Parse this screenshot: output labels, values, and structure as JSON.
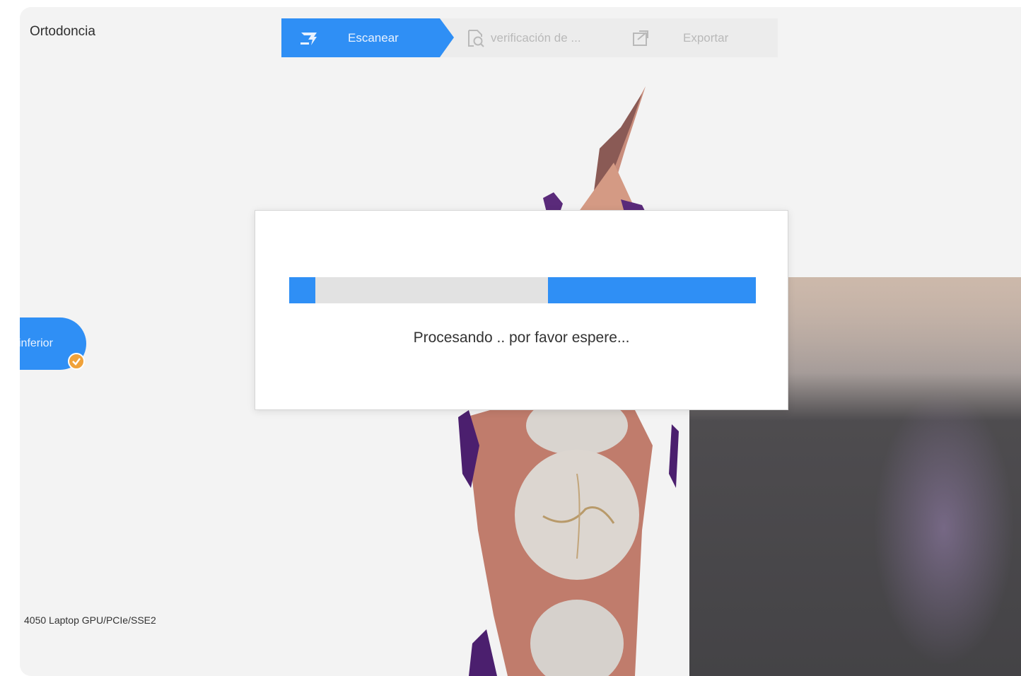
{
  "app": {
    "title": "Ortodoncia"
  },
  "workflow": {
    "steps": [
      {
        "label": "Escanear",
        "icon": "scan-icon",
        "state": "active"
      },
      {
        "label": "verificación de ...",
        "icon": "verify-icon",
        "state": "inactive"
      },
      {
        "label": "Exportar",
        "icon": "export-icon",
        "state": "inactive"
      }
    ]
  },
  "arch_selector": {
    "label": "inferior",
    "status_icon": "check-icon"
  },
  "status_bar": {
    "gpu_info": "4050 Laptop GPU/PCIe/SSE2"
  },
  "dialog": {
    "message": "Procesando .. por favor espere..."
  },
  "colors": {
    "accent": "#2f8ff5",
    "badge": "#f0a23a",
    "background": "#f3f3f3"
  }
}
